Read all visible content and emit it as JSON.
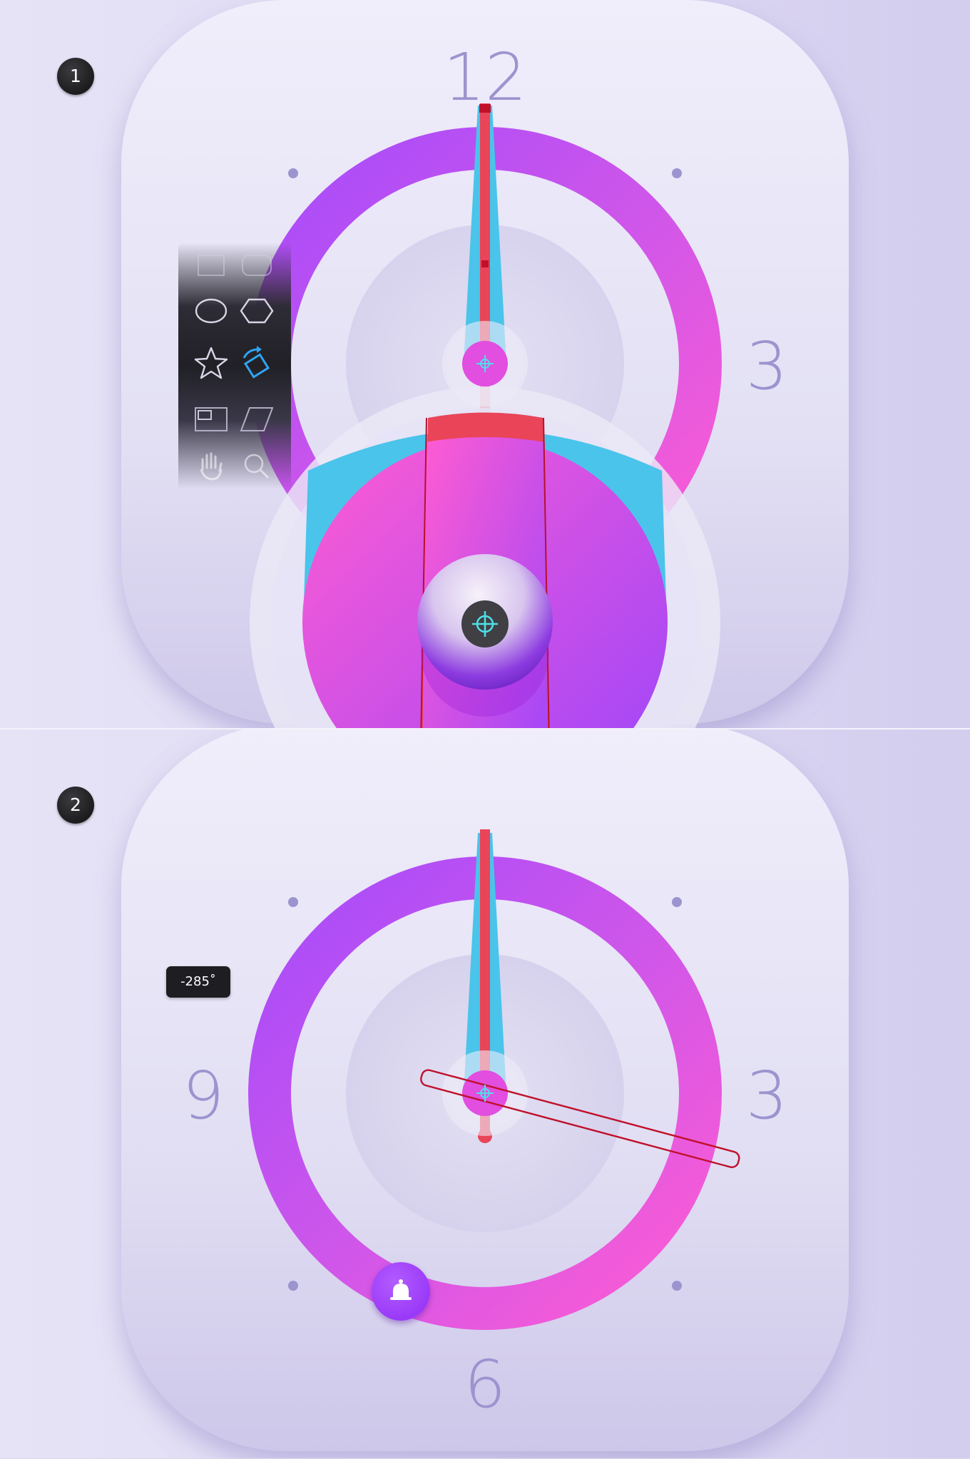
{
  "steps": {
    "step1": "1",
    "step2": "2"
  },
  "dial1": {
    "top": "12",
    "right": "3"
  },
  "dial2": {
    "left": "9",
    "right": "3",
    "bottom": "6"
  },
  "tooltip": {
    "angle": "-285˚"
  },
  "toolbar": {
    "tools": [
      "rectangle-icon",
      "rounded-rectangle-icon",
      "ellipse-icon",
      "polygon-icon",
      "star-icon",
      "rotate-shape-icon",
      "frame-icon",
      "parallelogram-icon",
      "hand-icon",
      "magnify-icon"
    ],
    "selected": "rotate-shape-icon"
  },
  "colors": {
    "ring_start": "#a64bfb",
    "ring_end": "#ff5cd2",
    "hand_blue": "#4ac4ea",
    "hand_red": "#e94458",
    "numeral": "#9b94cf",
    "bg": "#dedaf3"
  }
}
